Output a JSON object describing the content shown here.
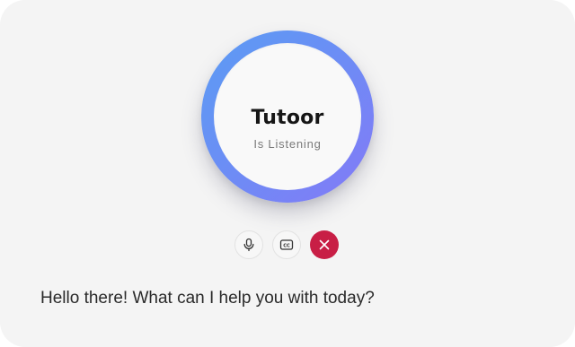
{
  "assistant": {
    "name": "Tutoor",
    "status": "Is Listening"
  },
  "controls": {
    "mic_icon": "microphone-icon",
    "captions_icon": "closed-captions-icon",
    "captions_label": "CC",
    "close_icon": "close-icon"
  },
  "message": {
    "text": "Hello there! What can I help you with today?"
  },
  "colors": {
    "ring_start": "#5b9cf3",
    "ring_end": "#8479f6",
    "close_button": "#c81e45",
    "background": "#f4f4f4"
  }
}
